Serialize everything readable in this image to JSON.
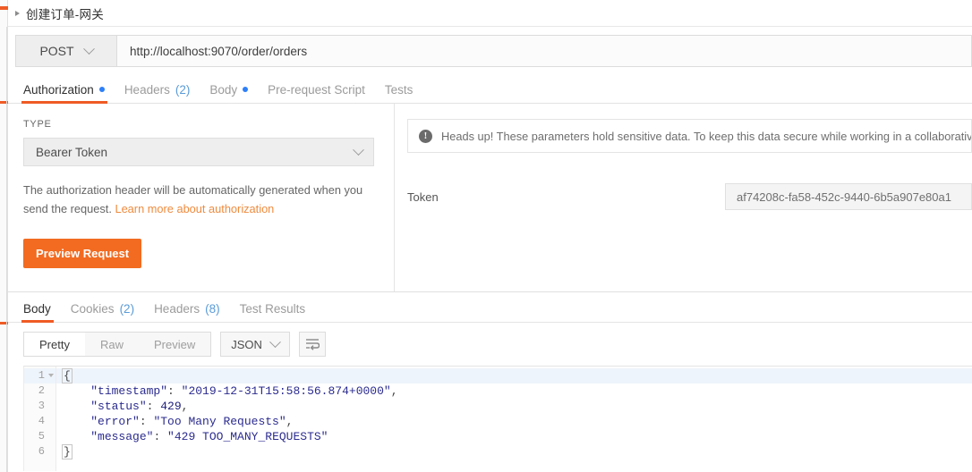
{
  "window": {
    "app": "Postman"
  },
  "request": {
    "title": "创建订单-网关",
    "collapse_icon": "triangle-right-icon",
    "method": "POST",
    "method_chevron": "chevron-down-icon",
    "url": "http://localhost:9070/order/orders",
    "tabs": [
      {
        "label": "Authorization",
        "badge_dot": true,
        "count": "",
        "active": true
      },
      {
        "label": "Headers",
        "badge_dot": false,
        "count": "(2)",
        "active": false
      },
      {
        "label": "Body",
        "badge_dot": true,
        "count": "",
        "active": false
      },
      {
        "label": "Pre-request Script",
        "badge_dot": false,
        "count": "",
        "active": false
      },
      {
        "label": "Tests",
        "badge_dot": false,
        "count": "",
        "active": false
      }
    ]
  },
  "auth": {
    "type_label": "TYPE",
    "type_value": "Bearer Token",
    "type_chevron": "chevron-down-icon",
    "help_text": "The authorization header will be automatically generated when you send the request. ",
    "help_link": "Learn more about authorization",
    "preview_button": "Preview Request",
    "notice_icon": "info-exclamation-icon",
    "notice_text": "Heads up! These parameters hold sensitive data. To keep this data secure while working in a collaborative e",
    "token_label": "Token",
    "token_value": "af74208c-fa58-452c-9440-6b5a907e80a1"
  },
  "response": {
    "tabs": [
      {
        "label": "Body",
        "count": "",
        "active": true
      },
      {
        "label": "Cookies",
        "count": "(2)",
        "active": false
      },
      {
        "label": "Headers",
        "count": "(8)",
        "active": false
      },
      {
        "label": "Test Results",
        "count": "",
        "active": false
      }
    ],
    "view_modes": [
      {
        "label": "Pretty",
        "active": true
      },
      {
        "label": "Raw",
        "active": false
      },
      {
        "label": "Preview",
        "active": false
      }
    ],
    "format": "JSON",
    "format_chevron": "chevron-down-icon",
    "wrap_icon": "word-wrap-icon",
    "code_lines": [
      {
        "num": "1",
        "foldable": true,
        "highlighted": true
      },
      {
        "num": "2",
        "foldable": false,
        "highlighted": false
      },
      {
        "num": "3",
        "foldable": false,
        "highlighted": false
      },
      {
        "num": "4",
        "foldable": false,
        "highlighted": false
      },
      {
        "num": "5",
        "foldable": false,
        "highlighted": false
      },
      {
        "num": "6",
        "foldable": false,
        "highlighted": false
      }
    ],
    "body": {
      "timestamp_key": "\"timestamp\"",
      "timestamp_value": "\"2019-12-31T15:58:56.874+0000\"",
      "status_key": "\"status\"",
      "status_value": "429",
      "error_key": "\"error\"",
      "error_value": "\"Too Many Requests\"",
      "message_key": "\"message\"",
      "message_value": "\"429 TOO_MANY_REQUESTS\"",
      "open_brace": "{",
      "close_brace": "}"
    }
  },
  "colors": {
    "accent": "#ef5b25",
    "button": "#f26b21",
    "dot": "#2d7ff9",
    "count": "#5a9bd8",
    "json": "#2b2b8f"
  }
}
